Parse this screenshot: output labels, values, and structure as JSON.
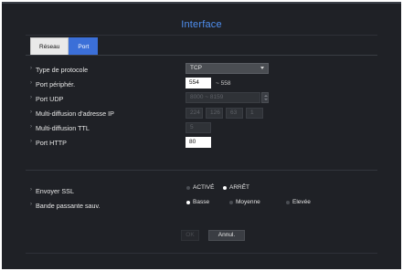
{
  "window": {
    "title": "Interface"
  },
  "tabs": [
    {
      "label": "Réseau",
      "active": false
    },
    {
      "label": "Port",
      "active": true
    }
  ],
  "fields": {
    "protocol": {
      "label": "Type de protocole",
      "value": "TCP"
    },
    "device_port": {
      "label": "Port périphér.",
      "value": "554",
      "range": "~ 558"
    },
    "udp_port": {
      "label": "Port UDP",
      "value": "8000 ~ 8159"
    },
    "multicast_ip": {
      "label": "Multi-diffusion d'adresse IP",
      "octets": [
        "224",
        "126",
        "63",
        "1"
      ]
    },
    "multicast_ttl": {
      "label": "Multi-diffusion TTL",
      "value": "5"
    },
    "http_port": {
      "label": "Port HTTP",
      "value": "80"
    }
  },
  "ssl": {
    "label": "Envoyer SSL",
    "options": [
      "ACTIVÉ",
      "ARRÊT"
    ],
    "selected": "ARRÊT"
  },
  "bandwidth": {
    "label": "Bande passante sauv.",
    "options": [
      "Basse",
      "Moyenne",
      "Elevée"
    ],
    "selected": "Basse"
  },
  "buttons": {
    "ok": "OK",
    "cancel": "Annul."
  },
  "colors": {
    "title": "#4f8ff0",
    "active_tab": "#3b6fd8",
    "background": "#1f2126"
  }
}
